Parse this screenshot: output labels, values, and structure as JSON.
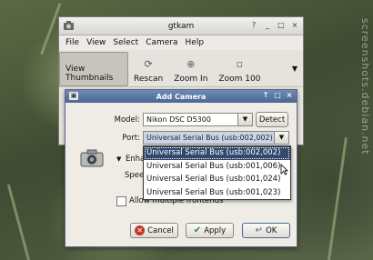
{
  "watermark": "screenshots.debian.net",
  "main": {
    "title": "gtkam",
    "menu": [
      "File",
      "View",
      "Select",
      "Camera",
      "Help"
    ],
    "toolbar": [
      {
        "label": "View Thumbnails",
        "icon": "thumbnails-icon"
      },
      {
        "label": "Rescan",
        "icon": "rescan-icon"
      },
      {
        "label": "Zoom In",
        "icon": "zoom-in-icon"
      },
      {
        "label": "Zoom 100",
        "icon": "zoom-100-icon"
      }
    ],
    "window_buttons": [
      "?",
      "_",
      "□",
      "×"
    ]
  },
  "dialog": {
    "title": "Add Camera",
    "model_label": "Model:",
    "model_value": "Nikon DSC D5300",
    "detect_label": "Detect",
    "port_label": "Port:",
    "port_value": "Universal Serial Bus (usb:002,002)",
    "enhanced_label": "Enha",
    "speed_label": "Spee",
    "allow_multiple_label": "Allow multiple frontends",
    "allow_multiple_checked": false,
    "buttons": {
      "cancel": "Cancel",
      "apply": "Apply",
      "ok": "OK"
    },
    "window_buttons": [
      "↑",
      "□",
      "×"
    ]
  },
  "port_options": [
    "Universal Serial Bus (usb:002,002)",
    "Universal Serial Bus (usb:001,006)",
    "Universal Serial Bus (usb:001,024)",
    "Universal Serial Bus (usb:001,023)"
  ],
  "selected_port_index": 0
}
